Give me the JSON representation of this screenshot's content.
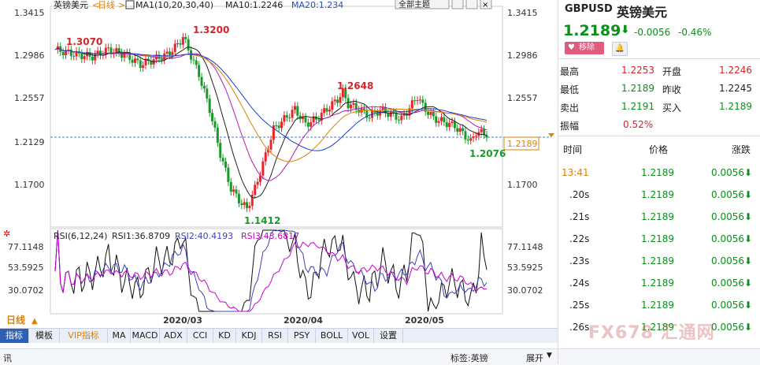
{
  "chart": {
    "title": "英镑美元",
    "period": "日线",
    "ma_label": "MA1(10,20,30,40)",
    "ma10": "MA10:1.2246",
    "ma20": "MA20:1.234",
    "theme_btn": "全部主题",
    "price_ticks": [
      "1.3415",
      "1.2986",
      "1.2557",
      "1.2129",
      "1.1700"
    ],
    "annotations": {
      "high1": "1.3070",
      "high2": "1.3200",
      "high3": "1.2648",
      "low1": "1.1412",
      "low2": "1.2076"
    },
    "current_price_tag": "1.2189",
    "rsi_label": "RSI(6,12,24)",
    "rsi1": "RSI1:36.8709",
    "rsi2": "RSI2:40.4193",
    "rsi3": "RSI3:43.6817",
    "rsi_ticks": [
      "77.1148",
      "53.5925",
      "30.0702"
    ],
    "date_labels": [
      "2020/03",
      "2020/04",
      "2020/05"
    ],
    "period_button": "日线",
    "colors": {
      "up": "#e8242c",
      "down": "#1a9a2a",
      "ma10": "#222222",
      "ma20": "#b020b0",
      "ma30": "#e08000",
      "ma40": "#1a3fd0",
      "rsi1": "#111111",
      "rsi2": "#4040c0",
      "rsi3": "#cc00cc"
    }
  },
  "chart_data": {
    "type": "candlestick",
    "title": "英镑美元 日线",
    "ylim": [
      1.14,
      1.35
    ],
    "x": [
      "2020/03",
      "2020/04",
      "2020/05"
    ],
    "annotations": [
      {
        "label": "1.3070",
        "value": 1.307
      },
      {
        "label": "1.3200",
        "value": 1.32
      },
      {
        "label": "1.2648",
        "value": 1.2648
      },
      {
        "label": "1.1412",
        "value": 1.1412
      },
      {
        "label": "1.2076",
        "value": 1.2076
      }
    ],
    "rsi_ticks": [
      77.1148,
      53.5925,
      30.0702
    ]
  },
  "toolbar": {
    "items": [
      "指标",
      "模板",
      "VIP指标",
      "MA",
      "MACD",
      "ADX",
      "CCI",
      "KD",
      "KDJ",
      "RSI",
      "PSY",
      "BOLL",
      "VOL",
      "设置"
    ]
  },
  "status": {
    "left": "讯",
    "center": "标签:英镑",
    "expand": "展开"
  },
  "quote": {
    "symbol": "GBPUSD",
    "name": "英镑美元",
    "price": "1.2189",
    "change": "-0.0056",
    "change_pct": "-0.46%",
    "remove_btn": "移除",
    "fields": [
      {
        "k1": "最高",
        "v1": "1.2253",
        "k2": "开盘",
        "v2": "1.2246"
      },
      {
        "k1": "最低",
        "v1": "1.2189",
        "k2": "昨收",
        "v2": "1.2245"
      },
      {
        "k1": "卖出",
        "v1": "1.2191",
        "k2": "买入",
        "v2": "1.2189"
      }
    ],
    "amp_label": "振幅",
    "amp_value": "0.52%",
    "table_headers": [
      "时间",
      "价格",
      "涨跌"
    ],
    "ticks": [
      {
        "time": "13:41",
        "price": "1.2189",
        "chg": "0.0056"
      },
      {
        "time": ".20s",
        "price": "1.2189",
        "chg": "0.0056"
      },
      {
        "time": ".21s",
        "price": "1.2189",
        "chg": "0.0056"
      },
      {
        "time": ".22s",
        "price": "1.2189",
        "chg": "0.0056"
      },
      {
        "time": ".23s",
        "price": "1.2189",
        "chg": "0.0056"
      },
      {
        "time": ".24s",
        "price": "1.2189",
        "chg": "0.0056"
      },
      {
        "time": ".25s",
        "price": "1.2189",
        "chg": "0.0056"
      },
      {
        "time": ".26s",
        "price": "1.2189",
        "chg": "0.0056"
      }
    ],
    "watermark": "FX678 汇通网"
  }
}
